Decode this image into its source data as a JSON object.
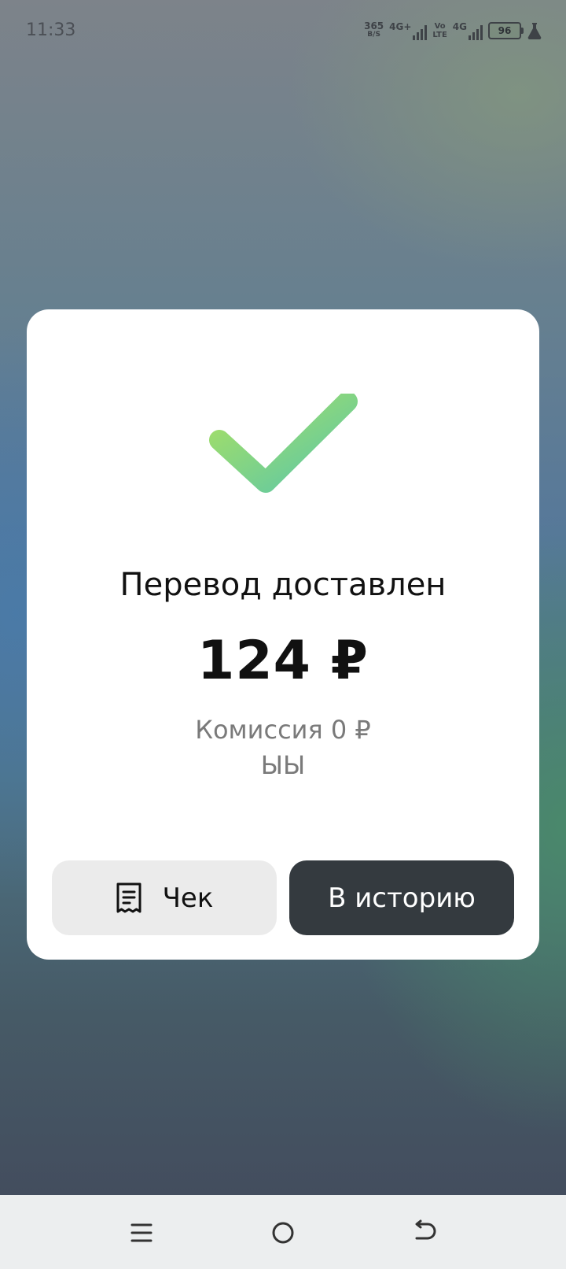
{
  "status_bar": {
    "time": "11:33",
    "net_speed_value": "365",
    "net_speed_unit": "B/S",
    "network1_label": "4G+",
    "volte_top": "Vo",
    "volte_bottom": "LTE",
    "network2_label": "4G",
    "battery": "96",
    "icons": [
      "signal-bars-icon",
      "battery-icon",
      "flask-icon"
    ]
  },
  "card": {
    "status_icon": "checkmark-icon",
    "title": "Перевод доставлен",
    "amount": "124 ₽",
    "commission": "Комиссия 0 ₽",
    "extra_text": "ЫЫ",
    "colors": {
      "check_start": "#a8e063",
      "check_end": "#5cc7a8",
      "history_button_bg": "#343a3f",
      "receipt_button_bg": "#ebebeb"
    }
  },
  "actions": {
    "receipt_label": "Чек",
    "receipt_icon": "receipt-icon",
    "history_label": "В историю"
  },
  "nav_bar": {
    "icons": [
      "menu-icon",
      "home-circle-icon",
      "back-arrow-icon"
    ]
  }
}
